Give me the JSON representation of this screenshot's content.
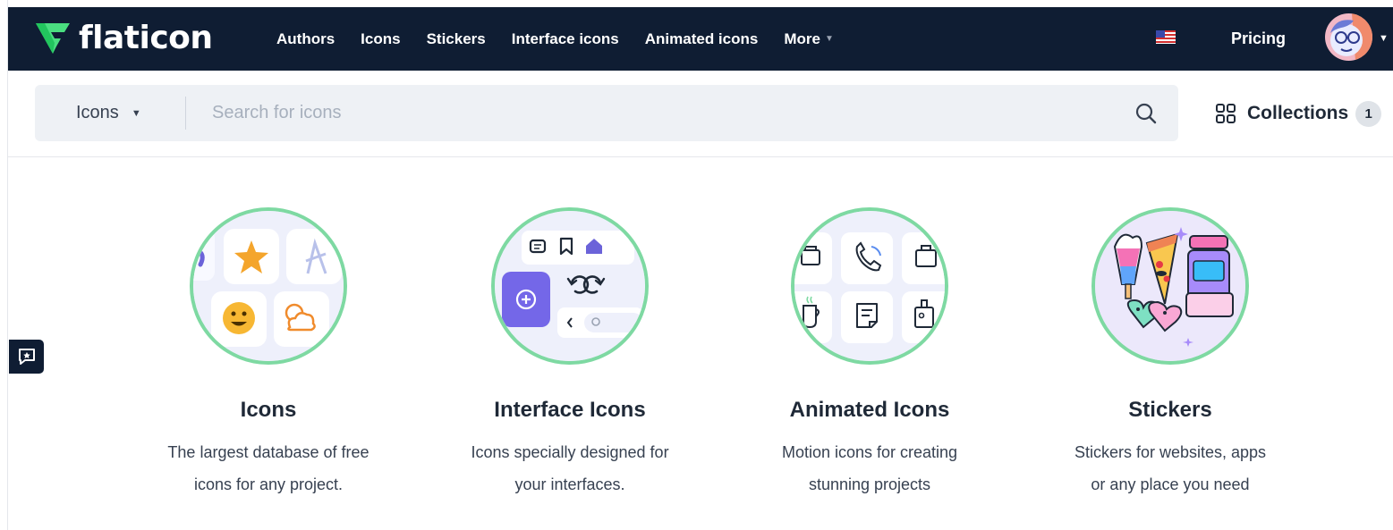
{
  "nav": {
    "logo_text": "flaticon",
    "links": [
      "Authors",
      "Icons",
      "Stickers",
      "Interface icons",
      "Animated icons"
    ],
    "more_label": "More",
    "pricing_label": "Pricing"
  },
  "search": {
    "type_label": "Icons",
    "placeholder": "Search for icons"
  },
  "collections": {
    "label": "Collections",
    "count": "1"
  },
  "categories": [
    {
      "title": "Icons",
      "description": "The largest database of free icons for any project."
    },
    {
      "title": "Interface Icons",
      "description": "Icons specially designed for your interfaces."
    },
    {
      "title": "Animated Icons",
      "description": "Motion icons for creating stunning projects"
    },
    {
      "title": "Stickers",
      "description": "Stickers for websites, apps or any place you need"
    }
  ],
  "colors": {
    "nav_bg": "#0f1d33",
    "accent_green": "#7ed9a2",
    "logo_green": "#4ade80",
    "search_bg": "#eef1f5"
  },
  "icons": [
    "flaticon-logo-icon",
    "us-flag-icon",
    "user-avatar-icon",
    "search-icon",
    "collections-grid-icon",
    "feedback-icon"
  ]
}
